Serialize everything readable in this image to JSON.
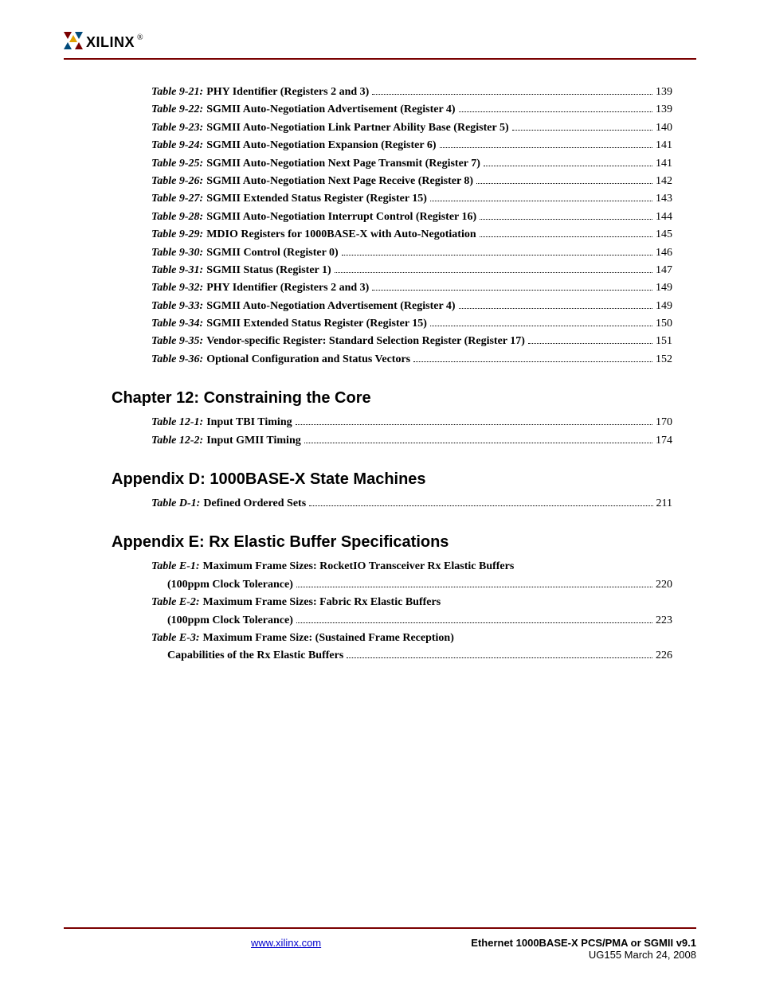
{
  "logo_text": "XILINX",
  "sections": [
    {
      "title": null,
      "entries": [
        {
          "label": "Table 9-21:",
          "title": "PHY Identifier (Registers 2 and 3)",
          "page": "139"
        },
        {
          "label": "Table 9-22:",
          "title": "SGMII Auto-Negotiation Advertisement (Register 4)",
          "page": "139"
        },
        {
          "label": "Table 9-23:",
          "title": "SGMII Auto-Negotiation Link Partner Ability Base (Register 5)",
          "page": "140"
        },
        {
          "label": "Table 9-24:",
          "title": "SGMII Auto-Negotiation Expansion (Register 6)",
          "page": "141"
        },
        {
          "label": "Table 9-25:",
          "title": "SGMII Auto-Negotiation Next Page Transmit (Register 7)",
          "page": "141"
        },
        {
          "label": "Table 9-26:",
          "title": "SGMII Auto-Negotiation Next Page Receive (Register 8)",
          "page": "142"
        },
        {
          "label": "Table 9-27:",
          "title": "SGMII Extended Status Register (Register 15)",
          "page": "143"
        },
        {
          "label": "Table 9-28:",
          "title": "SGMII Auto-Negotiation Interrupt Control (Register 16)",
          "page": "144"
        },
        {
          "label": "Table 9-29:",
          "title": "MDIO Registers for 1000BASE-X with Auto-Negotiation",
          "page": "145"
        },
        {
          "label": "Table 9-30:",
          "title": "SGMII Control (Register 0)",
          "page": "146"
        },
        {
          "label": "Table 9-31:",
          "title": "SGMII Status (Register 1)",
          "page": "147"
        },
        {
          "label": "Table 9-32:",
          "title": "PHY Identifier (Registers 2 and 3)",
          "page": "149"
        },
        {
          "label": "Table 9-33:",
          "title": "SGMII Auto-Negotiation Advertisement (Register 4)",
          "page": "149"
        },
        {
          "label": "Table 9-34:",
          "title": "SGMII Extended Status Register (Register 15)",
          "page": "150"
        },
        {
          "label": "Table 9-35:",
          "title": "Vendor-specific Register: Standard Selection Register (Register 17)",
          "page": "151"
        },
        {
          "label": "Table 9-36:",
          "title": "Optional Configuration and Status Vectors",
          "page": "152"
        }
      ]
    },
    {
      "title": "Chapter 12:  Constraining the Core",
      "entries": [
        {
          "label": "Table 12-1:",
          "title": "Input TBI Timing",
          "page": "170"
        },
        {
          "label": "Table 12-2:",
          "title": "Input GMII Timing",
          "page": "174"
        }
      ]
    },
    {
      "title": "Appendix D:  1000BASE-X State Machines",
      "entries": [
        {
          "label": "Table D-1:",
          "title": "Defined Ordered Sets",
          "page": "211"
        }
      ]
    },
    {
      "title": "Appendix E:  Rx Elastic Buffer Specifications",
      "entries": [
        {
          "label": "Table E-1:",
          "title": "Maximum Frame Sizes: RocketIO Transceiver Rx Elastic Buffers",
          "cont": "(100ppm Clock Tolerance)",
          "page": "220"
        },
        {
          "label": "Table E-2:",
          "title": "Maximum Frame Sizes: Fabric Rx Elastic Buffers",
          "cont": "(100ppm Clock Tolerance)",
          "page": "223"
        },
        {
          "label": "Table E-3:",
          "title": "Maximum Frame Size: (Sustained Frame Reception)",
          "cont": "Capabilities of the Rx Elastic Buffers",
          "page": "226"
        }
      ]
    }
  ],
  "footer": {
    "link": "www.xilinx.com",
    "doc_title": "Ethernet 1000BASE-X PCS/PMA or SGMII v9.1",
    "doc_sub": "UG155 March 24, 2008"
  }
}
